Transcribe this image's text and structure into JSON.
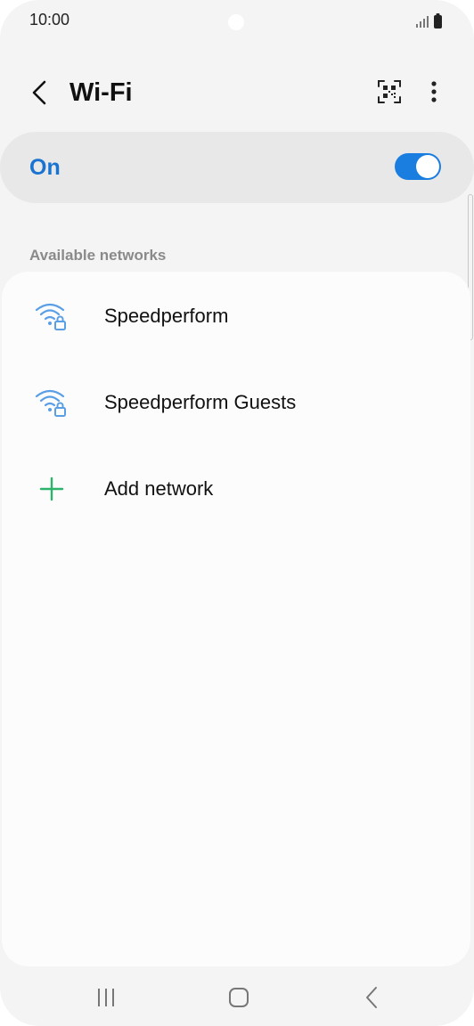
{
  "status_bar": {
    "time": "10:00",
    "signal_icon": "signal-bars-icon",
    "battery_icon": "battery-icon"
  },
  "header": {
    "back_icon": "chevron-left-icon",
    "title": "Wi-Fi",
    "qr_icon": "qr-code-scanner-icon",
    "more_icon": "more-vertical-icon"
  },
  "master_switch": {
    "label": "On",
    "state": "on",
    "accent_color": "#1a7ee0",
    "label_color": "#1a73d0"
  },
  "networks": {
    "section_title": "Available networks",
    "items": [
      {
        "label": "Speedperform",
        "icon": "wifi-locked-icon"
      },
      {
        "label": "Speedperform Guests",
        "icon": "wifi-locked-icon"
      },
      {
        "label": "Add network",
        "icon": "plus-icon"
      }
    ],
    "wifi_icon_color": "#5a9ee6",
    "add_icon_color": "#2db36a"
  },
  "navigation_bar": {
    "recents_icon": "recents-icon",
    "home_icon": "home-icon",
    "back_icon": "back-icon"
  }
}
